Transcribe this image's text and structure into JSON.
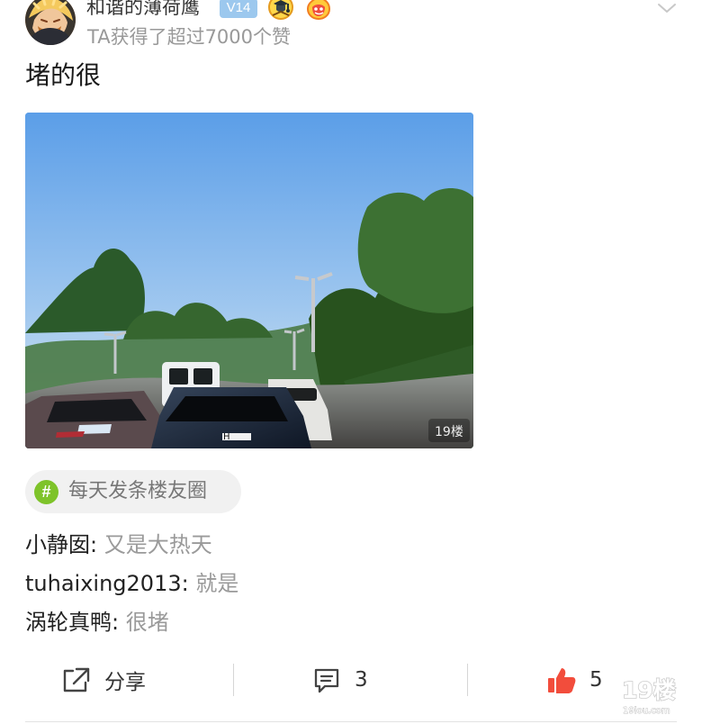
{
  "post": {
    "author": "和谐的薄荷鹰",
    "level": "V14",
    "likes_summary": "TA获得了超过7000个赞",
    "text": "堵的很",
    "photo_watermark": "19楼",
    "topic": "每天发条楼友圈",
    "topic_symbol": "#"
  },
  "comments": [
    {
      "author": "小静囡",
      "separator": ": ",
      "text": "又是大热天"
    },
    {
      "author": "tuhaixing2013",
      "separator": ": ",
      "text": "就是"
    },
    {
      "author": "涡轮真鸭",
      "separator": ": ",
      "text": "很堵"
    }
  ],
  "actions": {
    "share_label": "分享",
    "comment_count": "3",
    "like_count": "5"
  },
  "watermark": {
    "text": "19楼",
    "domain": "19lou.com"
  },
  "icons": {
    "expand": "chevron-down-icon",
    "share": "share-icon",
    "comment": "comment-icon",
    "like": "thumb-up-icon",
    "topic": "hashtag-icon"
  },
  "colors": {
    "level_badge": "#9cc8ee",
    "topic_icon": "#7ec32a",
    "like_icon": "#f24d3c",
    "secondary_text": "#999999"
  }
}
